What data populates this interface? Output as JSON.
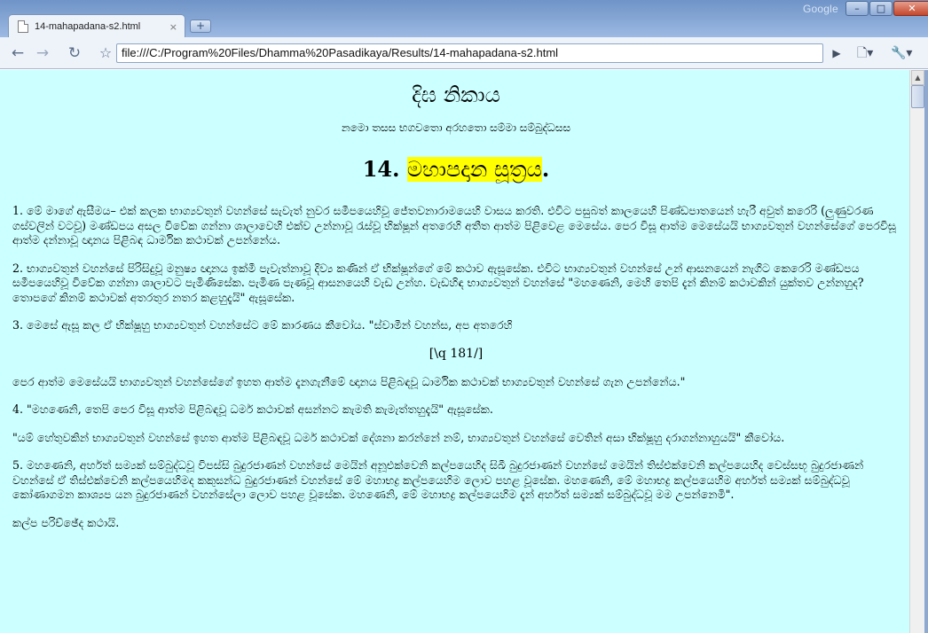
{
  "window": {
    "wordmark": "Google",
    "controls": {
      "minimize": "–",
      "maximize": "□",
      "close": "✕"
    }
  },
  "tab": {
    "title": "14-mahapadana-s2.html",
    "close_glyph": "×",
    "new_tab_glyph": "+"
  },
  "toolbar": {
    "back_glyph": "←",
    "forward_glyph": "→",
    "reload_glyph": "↻",
    "star_glyph": "☆",
    "url": "file:///C:/Program%20Files/Dhamma%20Pasadikaya/Results/14-mahapadana-s2.html",
    "go_glyph": "▶",
    "page_menu_glyph": "🗋▾",
    "wrench_menu_glyph": "🔧▾"
  },
  "page": {
    "heading": "දිඝ නිකාය",
    "invocation": "නමො තසස භගවතො අරහතො සම්මා සම්බුද්ධසස",
    "sutta_number": "14. ",
    "sutta_name": "මහාපදාන සූත්‍රය",
    "sutta_suffix": ".",
    "paragraphs_before_mark": [
      "1. මේ මාගේ ඇසීමය– එක් කලක භාග්‍යවතුන් වහන්සේ සැවැත් නුවර සමීපයෙහිවූ ජේතවනාරාමයෙහි වාසය කරති. එවිට පසුබත් කාලයෙහි පිණ්ඩපාතයෙන් හැරී අවුත් කරෙරි (ලුණුවරණ ගස්වලින් වටවූ) මණ්ඩපය අසල විවේක ගන්නා ශාලාවෙහි එක්ව උන්නාවූ රැස්වූ භික්ෂූන් අතරෙහි අතීත ආත්ම පිළිවෙළ මෙසේය. පෙර විසූ ආත්ම මෙසේයයි භාග්‍යවතුන් වහන්සේගේ පෙරවිසූ ආත්ම දන්නාවූ ඥානය පිළිබඳ ධාර්මික කථාවක් උපන්නේය.",
      "2. භාග්‍යවතුන් වහන්සේ පිරිසිදුවූ මනුෂ්‍ය ඥානය ඉක්මී පැවැත්නාවූ දිව්‍ය කණින් ඒ භික්ෂූන්ගේ මේ කථාව ඇසූසේක. එවිට භාග්‍යවතුන් වහන්සේ උන් ආසනයෙන් නැගිට කෙරෙරි මණ්ඩපය සමීපයෙහිවූ විවේක ගන්නා ශාලාවට පැමිණිසේක. පැමිණ පැණවූ ආසනයෙහි වැඩ උන්හ. වැඩහිඳ භාග්‍යවතුන් වහන්සේ \"මහණෙනි, මෙහි තෙපි දැන් කිනම් කථාවකින් යුක්තව උන්නහුද? තොපගේ කිනම් කථාවක් අතරතුර නතර කළහුදැයි\" ඇසූසේක.",
      "3. මෙසේ ඇසූ කල ඒ භික්ෂූහු භාග්‍යවතුන් වහන්සේට මේ කාරණය කීවෝය. \"ස්වාමීන් වහන්ස, අප අතරෙහි"
    ],
    "page_mark": "[\\q 181/]",
    "paragraphs_after_mark": [
      "පෙර ආත්ම මෙසේයයි භාග්‍යවතුන් වහන්සේගේ ඉහත ආත්ම දැනගැනීමේ ඥානය පිළිබඳවූ ධාර්මික කථාවක් භාග්‍යවතුන් වහන්සේ ගැන උපන්නේය.\"",
      "4. \"මහණෙනි, තෙපි පෙර විසූ ආත්ම පිළිබඳවූ ධර්ම කථාවක් අසන්නට කැමති කැමැත්තහුදැයි\" ඇසූසේක.",
      "\"යම් හේතුවකින් භාග්‍යවතුන් වහන්සේ ඉහත ආත්ම පිළිබඳවූ ධර්ම කථාවක් දේශනා කරන්නේ නම්, භාග්‍යවතුන් වහන්සේ වෙතින් අසා භික්ෂූහු දරාගන්නාහුයයි\" කීවෝය.",
      "5. මහණෙනි, අර්හත් සම්‍යක් සම්බුද්ධවූ විපස්සි බුදුරජාණන් වහන්සේ මෙයින් අනූඑක්වෙනි කල්පයෙහිද සිඛී බුදුරජාණන් වහන්සේ මෙයින් තිස්එක්වෙනි කල්පයෙහිද වෙස්සභූ බුදුරජාණන් වහන්සේ ඒ තිස්එක්වෙනි කල්පයෙහිමද කකුසන්ධ බුදුරජාණන් වහන්සේ මේ මහාභද්‍ර කල්පයෙහිම ලොව පහළ වූසේක. මහණෙනි, මේ මහාභද්‍ර කල්පයෙහිම අර්හත් සම්‍යක් සම්බුද්ධවූ කෝණාගමන කාශ්‍යප යන බුදුරජාණන් වහන්සේලා ලොව පහළ වූසේක. මහණෙනි, මේ මහාභද්‍ර කල්පයෙහිම දැන් අර්හත් සම්‍යක් සම්බුද්ධවූ මම උපන්නෙමි\".",
      "කල්ප පරිච්ඡේද කථායි."
    ]
  },
  "scrollbar": {
    "up_glyph": "▲",
    "position_fraction": 0.0
  },
  "colors": {
    "page_background": "#ccffff",
    "highlight": "#ffff00",
    "chrome_frame": "#8fa8cf"
  }
}
